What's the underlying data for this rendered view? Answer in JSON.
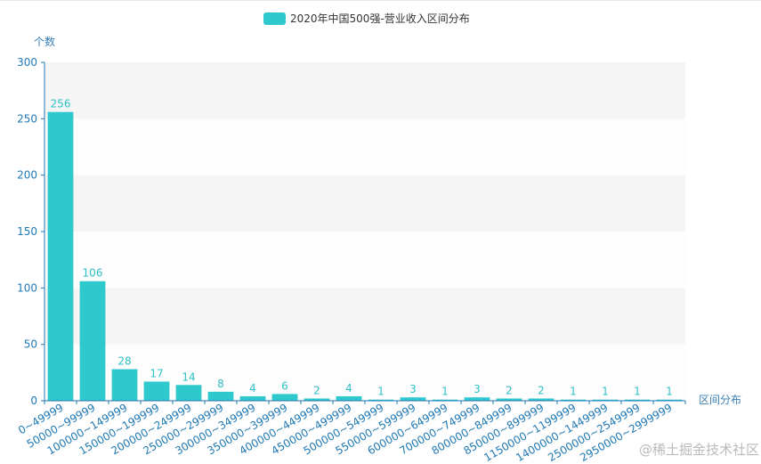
{
  "chart_data": {
    "type": "bar",
    "legend": "2020年中国500强-营业收入区间分布",
    "ylabel": "个数",
    "xlabel": "区间分布",
    "ylim": [
      0,
      300
    ],
    "yticks": [
      0,
      50,
      100,
      150,
      200,
      250,
      300
    ],
    "categories": [
      "0~49999",
      "50000~99999",
      "100000~149999",
      "150000~199999",
      "200000~249999",
      "250000~299999",
      "300000~349999",
      "350000~399999",
      "400000~449999",
      "450000~499999",
      "500000~549999",
      "550000~599999",
      "600000~649999",
      "700000~749999",
      "800000~849999",
      "850000~899999",
      "1150000~1199999",
      "1400000~1449999",
      "2500000~2549999",
      "2950000~2999999"
    ],
    "values": [
      256,
      106,
      28,
      17,
      14,
      8,
      4,
      6,
      2,
      4,
      1,
      3,
      1,
      3,
      2,
      2,
      1,
      1,
      1,
      1
    ],
    "legend_placement": "top-center",
    "grid": "alternating horizontal bands",
    "colors": {
      "bar": "#2fc8cc",
      "axis": "#1f78b4"
    }
  },
  "watermark": "@稀土掘金技术社区"
}
